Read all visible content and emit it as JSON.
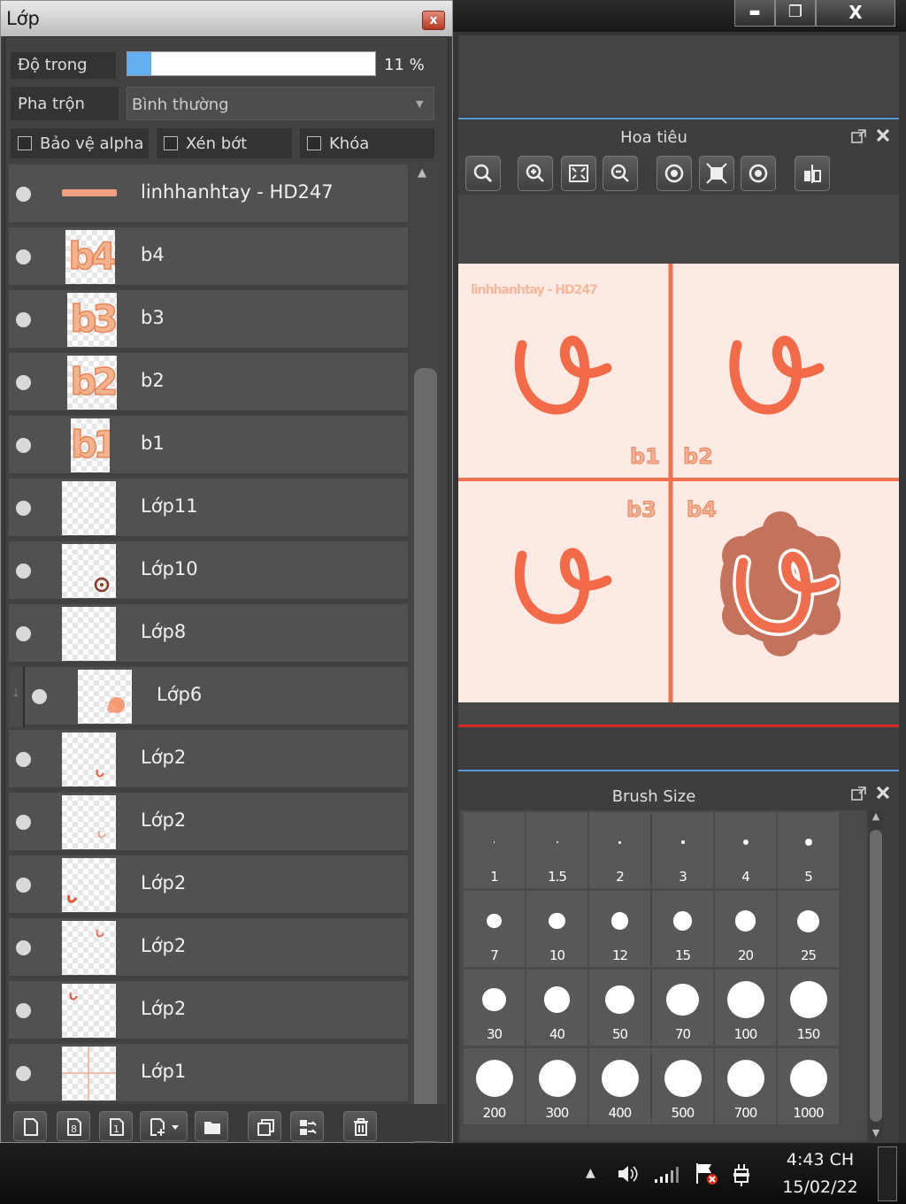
{
  "window_controls": {
    "minimize": "▬",
    "maximize": "❐",
    "close": "X"
  },
  "layer_panel": {
    "title": "Lớp",
    "close_label": "x",
    "opacity_label": "Độ trong",
    "opacity_value": "11 %",
    "opacity_percent": 11,
    "blend_label": "Pha trộn",
    "blend_value": "Bình thường",
    "checkboxes": [
      {
        "label": "Bảo vệ alpha",
        "checked": false
      },
      {
        "label": "Xén bớt",
        "checked": false
      },
      {
        "label": "Khóa",
        "checked": false
      }
    ],
    "layers": [
      {
        "name": "linhhanhtay - HD247",
        "thumb": "text-strip"
      },
      {
        "name": "b4",
        "thumb": "b4"
      },
      {
        "name": "b3",
        "thumb": "b3"
      },
      {
        "name": "b2",
        "thumb": "b2"
      },
      {
        "name": "b1",
        "thumb": "b1"
      },
      {
        "name": "Lớp11",
        "thumb": "empty"
      },
      {
        "name": "Lớp10",
        "thumb": "small-circle"
      },
      {
        "name": "Lớp8",
        "thumb": "empty"
      },
      {
        "name": "Lớp6",
        "thumb": "orange-splash",
        "clipped": true
      },
      {
        "name": "Lớp2",
        "thumb": "sketch-a"
      },
      {
        "name": "Lớp2",
        "thumb": "sketch-b"
      },
      {
        "name": "Lớp2",
        "thumb": "sketch-c"
      },
      {
        "name": "Lớp2",
        "thumb": "sketch-d"
      },
      {
        "name": "Lớp2",
        "thumb": "sketch-e"
      },
      {
        "name": "Lớp1",
        "thumb": "grid-lines"
      }
    ],
    "toolbar_icons": [
      "new-layer-icon",
      "new-vector-layer-icon",
      "new-1bit-layer-icon",
      "add-layer-dropdown-icon",
      "new-folder-icon",
      "duplicate-layer-icon",
      "merge-layer-icon",
      "delete-layer-icon"
    ]
  },
  "navigator": {
    "title": "Hoa tiêu",
    "buttons": [
      "zoom-reset-icon",
      "zoom-in-icon",
      "fit-screen-icon",
      "zoom-out-icon",
      "rotate-left-icon",
      "actual-size-icon",
      "rotate-right-icon",
      "flip-icon"
    ],
    "canvas": {
      "watermark": "linhhanhtay - HD247",
      "labels": [
        "b1",
        "b2",
        "b3",
        "b4"
      ],
      "bg_color": "#fde9e3",
      "accent": "#f07050"
    }
  },
  "brush_size": {
    "title": "Brush Size",
    "sizes": [
      "1",
      "1.5",
      "2",
      "3",
      "4",
      "5",
      "7",
      "10",
      "12",
      "15",
      "20",
      "25",
      "30",
      "40",
      "50",
      "70",
      "100",
      "150",
      "200",
      "300",
      "400",
      "500",
      "700",
      "1000"
    ]
  },
  "taskbar": {
    "time": "4:43 CH",
    "date": "15/02/22"
  }
}
